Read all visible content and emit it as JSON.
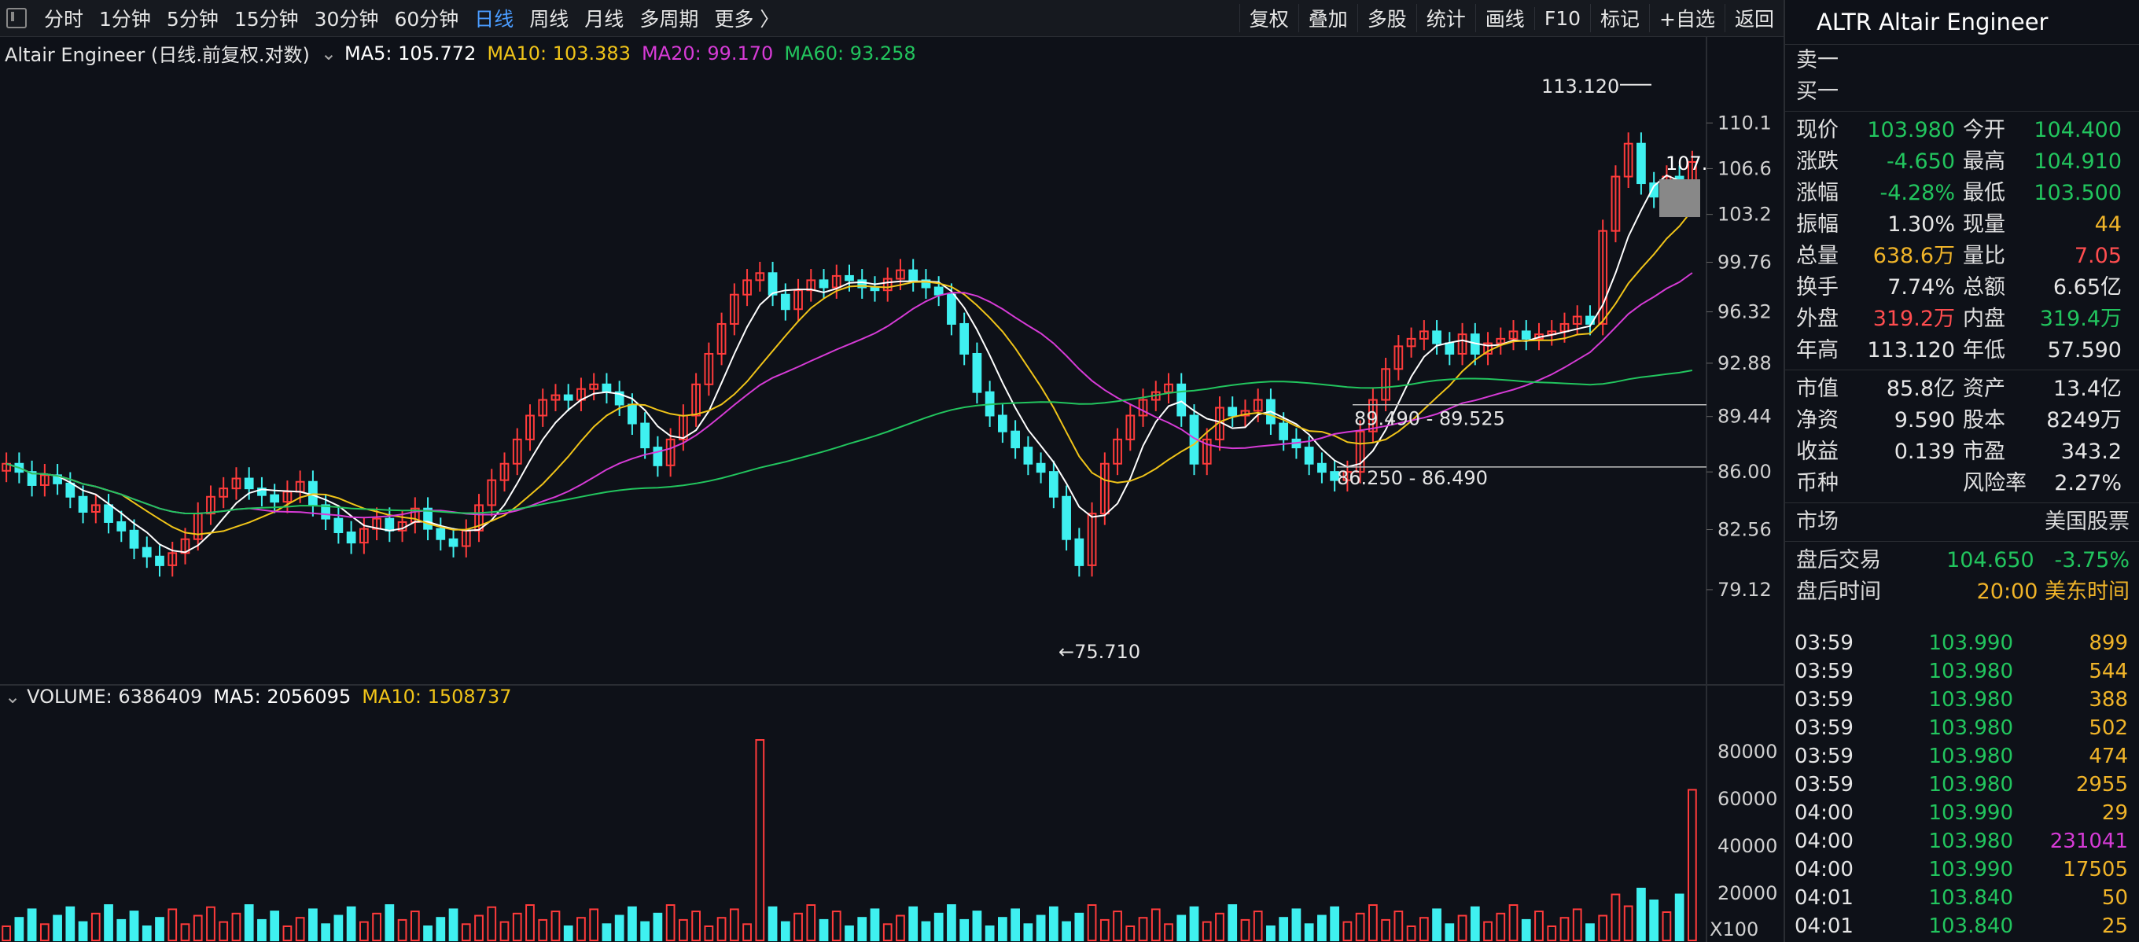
{
  "toolbar": {
    "periods": [
      "分时",
      "1分钟",
      "5分钟",
      "15分钟",
      "30分钟",
      "60分钟",
      "日线",
      "周线",
      "月线",
      "多周期",
      "更多 〉"
    ],
    "active_period": "日线",
    "tools": [
      "复权",
      "叠加",
      "多股",
      "统计",
      "画线",
      "F10",
      "标记",
      "+自选",
      "返回"
    ]
  },
  "chart": {
    "stock_desc": "Altair Engineer (日线.前复权.对数)",
    "ma5": "MA5: 105.772",
    "ma10": "MA10: 103.383",
    "ma20": "MA20: 99.170",
    "ma60": "MA60: 93.258",
    "price_axis": [
      "110.1",
      "106.6",
      "103.2",
      "99.76",
      "96.32",
      "92.88",
      "89.44",
      "86.00",
      "82.56",
      "79.12"
    ],
    "current_price_tag": "107.",
    "annotation_high": "113.120",
    "annotation_low": "75.710",
    "range1": "89.490 - 89.525",
    "range2": "86.250 - 86.490",
    "volume_label": "VOLUME: 6386409",
    "vol_ma5": "MA5: 2056095",
    "vol_ma10": "MA10: 1508737",
    "volume_axis": [
      "80000",
      "60000",
      "40000",
      "20000"
    ],
    "volume_unit": "X100",
    "colors": {
      "up": "#ff3b3b",
      "down": "#3ff0f0",
      "ma5": "#ffffff",
      "ma10": "#f0c419",
      "ma20": "#d63bd6",
      "ma60": "#22c55e"
    }
  },
  "chart_data": {
    "type": "candlestick",
    "price_range": [
      75.71,
      113.12
    ],
    "closes": [
      86.5,
      86.0,
      85.2,
      85.8,
      85.3,
      84.5,
      83.6,
      84.0,
      83.0,
      82.5,
      81.5,
      81.0,
      80.5,
      81.2,
      82.0,
      83.5,
      84.5,
      85.0,
      85.6,
      85.0,
      84.6,
      84.2,
      84.8,
      85.4,
      84.0,
      83.2,
      82.4,
      81.8,
      82.6,
      83.2,
      82.5,
      83.0,
      83.8,
      82.6,
      82.0,
      81.6,
      82.5,
      84.0,
      85.5,
      86.5,
      88.0,
      89.5,
      90.5,
      90.8,
      90.5,
      91.2,
      91.5,
      91.0,
      90.2,
      89.0,
      87.5,
      86.4,
      88.0,
      89.5,
      91.5,
      93.5,
      95.5,
      97.5,
      98.5,
      99.0,
      97.5,
      96.5,
      97.8,
      98.5,
      98.0,
      98.8,
      98.5,
      98.0,
      97.8,
      98.6,
      99.2,
      98.5,
      98.0,
      97.5,
      95.5,
      93.5,
      91.0,
      89.5,
      88.5,
      87.5,
      86.5,
      86.0,
      84.5,
      82.0,
      80.5,
      83.5,
      86.5,
      88.0,
      89.5,
      90.5,
      91.0,
      91.5,
      89.5,
      86.5,
      88.0,
      90.0,
      89.5,
      89.8,
      90.5,
      89.0,
      88.0,
      87.5,
      86.5,
      86.0,
      85.5,
      86.0,
      88.5,
      90.5,
      92.5,
      94.0,
      94.5,
      95.0,
      94.2,
      93.5,
      94.8,
      93.5,
      94.2,
      94.5,
      95.0,
      94.5,
      94.8,
      95.0,
      95.5,
      96.0,
      95.5,
      102.0,
      106.0,
      108.5,
      105.5,
      104.5,
      106.0,
      103.9,
      107.1
    ],
    "volume_ma5": 2056095,
    "volume_ma10": 1508737
  },
  "quote": {
    "title": "ALTR Altair Engineer",
    "sell1": "卖一",
    "buy1": "买一",
    "rows": [
      [
        {
          "l": "现价",
          "v": "103.980",
          "c": "g"
        },
        {
          "l": "今开",
          "v": "104.400",
          "c": "g"
        }
      ],
      [
        {
          "l": "涨跌",
          "v": "-4.650",
          "c": "g"
        },
        {
          "l": "最高",
          "v": "104.910",
          "c": "g"
        }
      ],
      [
        {
          "l": "涨幅",
          "v": "-4.28%",
          "c": "g"
        },
        {
          "l": "最低",
          "v": "103.500",
          "c": "g"
        }
      ],
      [
        {
          "l": "振幅",
          "v": "1.30%",
          "c": "w"
        },
        {
          "l": "现量",
          "v": "44",
          "c": "y"
        }
      ],
      [
        {
          "l": "总量",
          "v": "638.6万",
          "c": "y"
        },
        {
          "l": "量比",
          "v": "7.05",
          "c": "r"
        }
      ],
      [
        {
          "l": "换手",
          "v": "7.74%",
          "c": "w"
        },
        {
          "l": "总额",
          "v": "6.65亿",
          "c": "w"
        }
      ],
      [
        {
          "l": "外盘",
          "v": "319.2万",
          "c": "r"
        },
        {
          "l": "内盘",
          "v": "319.4万",
          "c": "g"
        }
      ],
      [
        {
          "l": "年高",
          "v": "113.120",
          "c": "w"
        },
        {
          "l": "年低",
          "v": "57.590",
          "c": "w"
        }
      ]
    ],
    "rows2": [
      [
        {
          "l": "市值",
          "v": "85.8亿",
          "c": "w"
        },
        {
          "l": "资产",
          "v": "13.4亿",
          "c": "w"
        }
      ],
      [
        {
          "l": "净资",
          "v": "9.590",
          "c": "w"
        },
        {
          "l": "股本",
          "v": "8249万",
          "c": "w"
        }
      ],
      [
        {
          "l": "收益",
          "v": "0.139",
          "c": "w"
        },
        {
          "l": "市盈",
          "v": "343.2",
          "c": "w"
        }
      ],
      [
        {
          "l": "币种",
          "v": "",
          "c": "w"
        },
        {
          "l": "风险率",
          "v": "2.27%",
          "c": "w"
        }
      ]
    ],
    "market_label": "市场",
    "market_value": "美国股票",
    "after_label": "盘后交易",
    "after_price": "104.650",
    "after_change": "-3.75%",
    "after_time_label": "盘后时间",
    "after_time": "20:00 美东时间"
  },
  "ticks": [
    {
      "t": "03:59",
      "p": "103.990",
      "v": "899",
      "vc": "y"
    },
    {
      "t": "03:59",
      "p": "103.980",
      "v": "544",
      "vc": "y"
    },
    {
      "t": "03:59",
      "p": "103.980",
      "v": "388",
      "vc": "y"
    },
    {
      "t": "03:59",
      "p": "103.980",
      "v": "502",
      "vc": "y"
    },
    {
      "t": "03:59",
      "p": "103.980",
      "v": "474",
      "vc": "y"
    },
    {
      "t": "03:59",
      "p": "103.980",
      "v": "2955",
      "vc": "y"
    },
    {
      "t": "04:00",
      "p": "103.990",
      "v": "29",
      "vc": "y"
    },
    {
      "t": "04:00",
      "p": "103.980",
      "v": "231041",
      "vc": "m"
    },
    {
      "t": "04:00",
      "p": "103.990",
      "v": "17505",
      "vc": "y"
    },
    {
      "t": "04:01",
      "p": "103.840",
      "v": "50",
      "vc": "y"
    },
    {
      "t": "04:01",
      "p": "103.840",
      "v": "25",
      "vc": "y"
    }
  ]
}
